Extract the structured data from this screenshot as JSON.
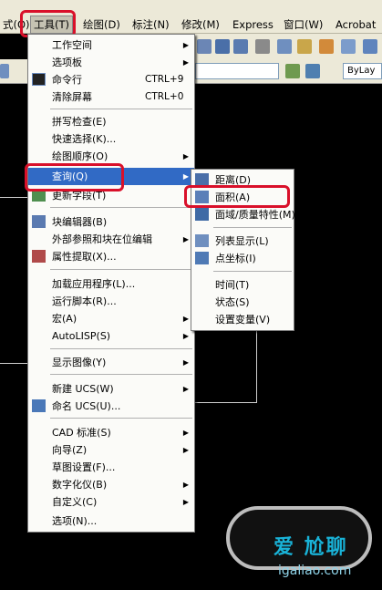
{
  "menubar": {
    "items": [
      {
        "label": "式(O)"
      },
      {
        "label": "工具(T)"
      },
      {
        "label": "绘图(D)"
      },
      {
        "label": "标注(N)"
      },
      {
        "label": "修改(M)"
      },
      {
        "label": "Express"
      },
      {
        "label": "窗口(W)"
      },
      {
        "label": "Acrobat"
      }
    ]
  },
  "toolbar": {
    "layer_combo_value": "ByLay"
  },
  "tools_menu": {
    "items": [
      {
        "label": "工作空间",
        "shortcut": "",
        "submenu": true
      },
      {
        "label": "选项板",
        "shortcut": "",
        "submenu": true
      },
      {
        "label": "命令行",
        "shortcut": "CTRL+9",
        "submenu": false
      },
      {
        "label": "清除屏幕",
        "shortcut": "CTRL+0",
        "submenu": false
      },
      {
        "label": "拼写检查(E)",
        "shortcut": "",
        "submenu": false
      },
      {
        "label": "快速选择(K)...",
        "shortcut": "",
        "submenu": false
      },
      {
        "label": "绘图顺序(O)",
        "shortcut": "",
        "submenu": true
      },
      {
        "label": "查询(Q)",
        "shortcut": "",
        "submenu": true
      },
      {
        "label": "更新字段(T)",
        "shortcut": "",
        "submenu": false
      },
      {
        "label": "块编辑器(B)",
        "shortcut": "",
        "submenu": false
      },
      {
        "label": "外部参照和块在位编辑",
        "shortcut": "",
        "submenu": true
      },
      {
        "label": "属性提取(X)...",
        "shortcut": "",
        "submenu": false
      },
      {
        "label": "加载应用程序(L)...",
        "shortcut": "",
        "submenu": false
      },
      {
        "label": "运行脚本(R)...",
        "shortcut": "",
        "submenu": false
      },
      {
        "label": "宏(A)",
        "shortcut": "",
        "submenu": true
      },
      {
        "label": "AutoLISP(S)",
        "shortcut": "",
        "submenu": true
      },
      {
        "label": "显示图像(Y)",
        "shortcut": "",
        "submenu": true
      },
      {
        "label": "新建 UCS(W)",
        "shortcut": "",
        "submenu": true
      },
      {
        "label": "命名 UCS(U)...",
        "shortcut": "",
        "submenu": false
      },
      {
        "label": "CAD 标准(S)",
        "shortcut": "",
        "submenu": true
      },
      {
        "label": "向导(Z)",
        "shortcut": "",
        "submenu": true
      },
      {
        "label": "草图设置(F)...",
        "shortcut": "",
        "submenu": false
      },
      {
        "label": "数字化仪(B)",
        "shortcut": "",
        "submenu": true
      },
      {
        "label": "自定义(C)",
        "shortcut": "",
        "submenu": true
      },
      {
        "label": "选项(N)...",
        "shortcut": "",
        "submenu": false
      }
    ]
  },
  "query_menu": {
    "items": [
      {
        "label": "距离(D)"
      },
      {
        "label": "面积(A)"
      },
      {
        "label": "面域/质量特性(M)"
      },
      {
        "label": "列表显示(L)"
      },
      {
        "label": "点坐标(I)"
      },
      {
        "label": "时间(T)"
      },
      {
        "label": "状态(S)"
      },
      {
        "label": "设置变量(V)"
      }
    ]
  },
  "watermark": {
    "text1": "爱 尬聊",
    "text2": "igaliao.com"
  },
  "colors": {
    "menu_highlight": "#316ac5",
    "annotation_red": "#d9102a",
    "canvas": "#000000"
  }
}
